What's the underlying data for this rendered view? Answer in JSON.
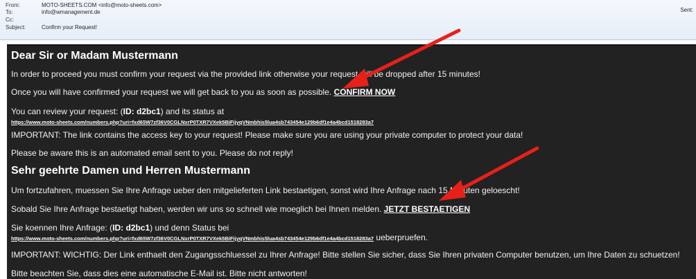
{
  "header": {
    "from_label": "From:",
    "from_value": "MOTO-SHEETS.COM <info@moto-sheets.com>",
    "to_label": "To:",
    "to_value": "info@wmanagement.de",
    "cc_label": "Cc:",
    "cc_value": "",
    "subject_label": "Subject:",
    "subject_value": "Confirm your Request!",
    "sent_label": "Sent:"
  },
  "email": {
    "en_heading": "Dear Sir or Madam Mustermann",
    "en_line1": "In order to proceed you must confirm your request via the provided link otherwise your request will be dropped after 15 minutes!",
    "en_line2": "Once you will have confirmed your request we will get back to you as soon as possible.",
    "en_confirm": "CONFIRM NOW",
    "en_review_pre": "You can review your request: (",
    "en_id": "ID: d2bc1",
    "en_review_post": ") and its status at",
    "en_url": "https://www.moto-sheets.com/numbers.php?uri=fxd65W7zf36V0CGLNxrP0TXR7VXek5BiFijyqVNmbhis5lua4sb743454e129b6df1e4a4bcd1518283a7",
    "en_important": "IMPORTANT: The link contains the access key to your request! Please make sure you are using your private computer to protect your data!",
    "en_auto": "Please be aware this is an automated email sent to you. Please do not reply!",
    "de_heading": "Sehr geehrte Damen und Herren Mustermann",
    "de_line1": "Um fortzufahren, muessen Sie Ihre Anfrage ueber den mitgelieferten Link bestaetigen, sonst wird Ihre Anfrage nach 15 Minuten geloescht!",
    "de_line2": "Sobald Sie Ihre Anfrage bestaetigt haben, werden wir uns so schnell wie moeglich bei Ihnen melden.",
    "de_confirm": "JETZT BESTAETIGEN",
    "de_review_pre": "Sie koennen Ihre Anfrage: (",
    "de_id": "ID: d2bc1",
    "de_review_post": ") und denn Status bei",
    "de_url": "https://www.moto-sheets.com/numbers.php?uri=fxd65W7zf36V0CGLNxrP0TXR7VXek5BiFijyqVNmbhis5lua4sb743454e129b6df1e4a4bcd1518283a7",
    "de_url_suffix": "ueberpruefen.",
    "de_important": "IMPORTANT: WICHTIG: Der Link enthaelt den Zugangsschluessel zu Ihrer Anfrage! Bitte stellen Sie sicher, dass Sie Ihren privaten Computer benutzen, um Ihre Daten zu schuetzen!",
    "de_auto": "Bitte beachten Sie, dass dies eine automatische E-Mail ist. Bitte nicht antworten!"
  },
  "colors": {
    "email_bg": "#222222",
    "arrow": "#e8201a"
  }
}
